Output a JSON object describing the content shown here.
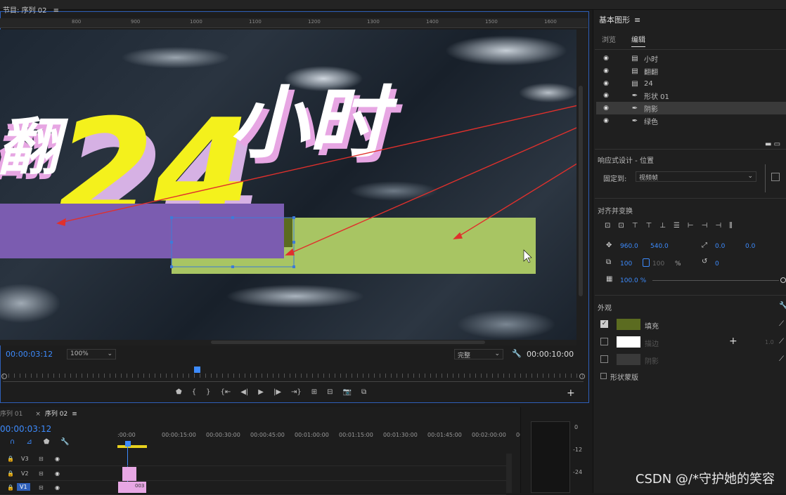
{
  "program": {
    "title": "节目: 序列 02",
    "menu_icon": "≡"
  },
  "ruler_ticks": [
    "800",
    "900",
    "1000",
    "1100",
    "1200",
    "1300",
    "1400",
    "1500",
    "1600"
  ],
  "canvas": {
    "text_part1": "翻",
    "text_part2": "24",
    "text_part3": "小时",
    "colors": {
      "purple": "#7b5cb0",
      "green": "#a8c563",
      "olive": "#5b6b20",
      "yellow": "#f4f11c",
      "arrow": "#e0302c"
    }
  },
  "program_controls": {
    "timecode": "00:00:03:12",
    "zoom": "100%",
    "quality": "完整",
    "duration": "00:00:10:00"
  },
  "timeline": {
    "tab1": "序列 01",
    "tab2": "序列 02",
    "timecode": "00:00:03:12",
    "ruler": [
      ":00:00",
      "00:00:15:00",
      "00:00:30:00",
      "00:00:45:00",
      "00:01:00:00",
      "00:01:15:00",
      "00:01:30:00",
      "00:01:45:00",
      "00:02:00:00",
      "00"
    ],
    "tracks": [
      "V3",
      "V2",
      "V1"
    ],
    "clip_label": "003"
  },
  "meter": {
    "labels": [
      "0",
      "-12",
      "-24"
    ]
  },
  "essential_graphics": {
    "title": "基本图形",
    "tab_browse": "浏览",
    "tab_edit": "编辑",
    "layers": [
      {
        "name": "小时",
        "type": "text"
      },
      {
        "name": "翻翻",
        "type": "text"
      },
      {
        "name": "24",
        "type": "text"
      },
      {
        "name": "形状 01",
        "type": "shape"
      },
      {
        "name": "阴影",
        "type": "shape",
        "selected": true
      },
      {
        "name": "绿色",
        "type": "shape"
      }
    ],
    "responsive_title": "响应式设计 - 位置",
    "pin_label": "固定到:",
    "pin_value": "视频帧",
    "align_title": "对齐并变换",
    "position_x": "960.0",
    "position_y": "540.0",
    "anchor_x": "0.0",
    "anchor_y": "0.0",
    "scale": "100",
    "scale2": "100",
    "percent": "%",
    "rotation": "0",
    "opacity": "100.0 %",
    "appearance_title": "外观",
    "fill_label": "填充",
    "stroke_label": "描边",
    "shadow_label": "阴影",
    "stroke_value": "1.0",
    "mask_label": "形状蒙版",
    "fill_color": "#5b6b20",
    "stroke_color": "#ffffff",
    "shadow_color": "#3a3a3a"
  },
  "watermark": "CSDN @/*守护她的笑容"
}
